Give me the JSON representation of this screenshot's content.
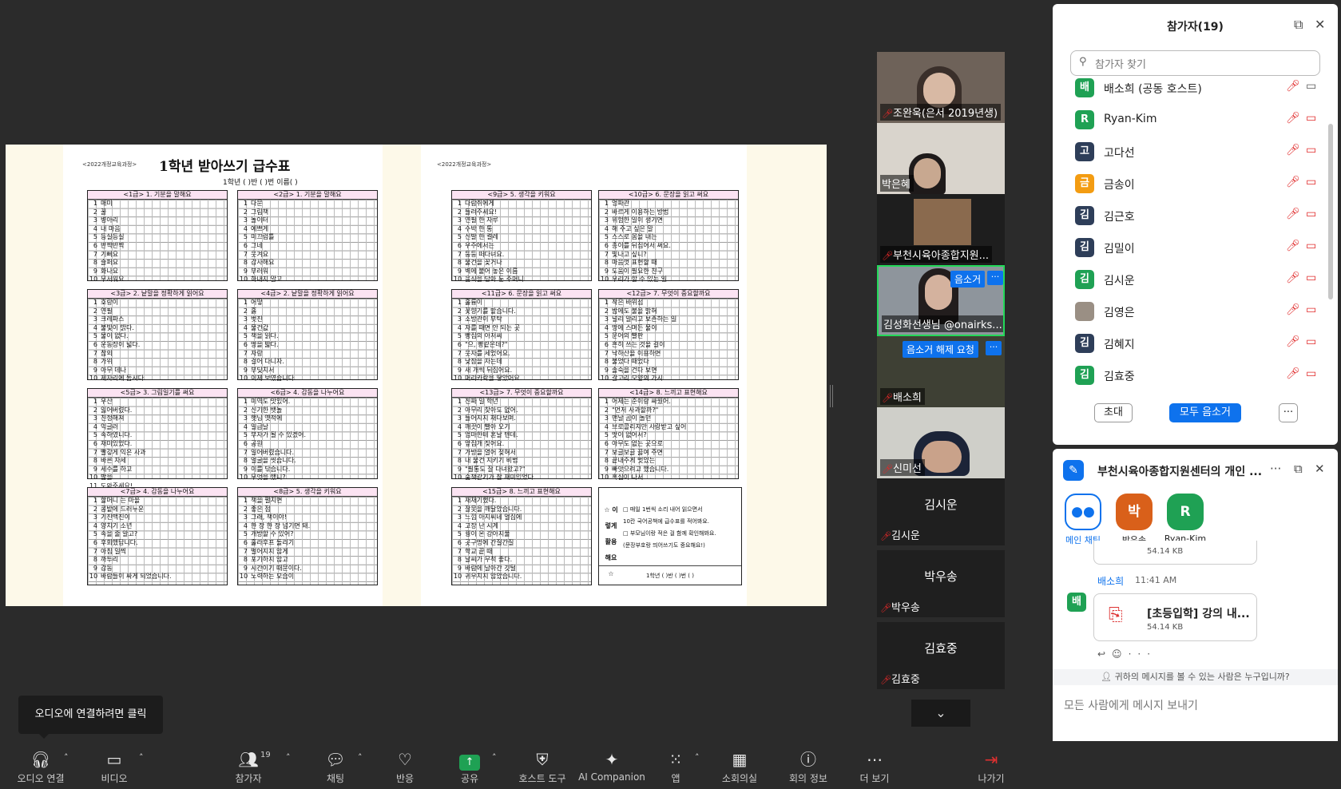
{
  "document": {
    "left_header": "<2022개정교육과정>",
    "right_header": "<2022개정교육과정>",
    "title": "1학년 받아쓰기 급수표",
    "subline": "1학년 (    )반 (    )번 이름(             )",
    "boxes": [
      {
        "title": "<1급> 1. 기분을 말해요",
        "rows": [
          "매미",
          "꿀",
          "병아리",
          "내 마음",
          "등실등실",
          "반짝반짝",
          "기뻐요",
          "슬퍼요",
          "화나요",
          "무서워요"
        ]
      },
      {
        "title": "<2급> 1. 기분을 말해요",
        "rows": [
          "다문",
          "그림책",
          "놀이터",
          "예쁘게",
          "미끄럼틀",
          "그네",
          "웃겨요",
          "감사해요",
          "부러워",
          "하내지 말고"
        ]
      },
      {
        "title": "<3급> 2. 낱말을 정확하게 읽어요",
        "rows": [
          "호랑이",
          "연필",
          "크레파스",
          "불빛이 밝다.",
          "물이 없다.",
          "운동장이 넓다.",
          "참외",
          "가위",
          "아무 데나",
          "제자리에 둡시다."
        ]
      },
      {
        "title": "<4급> 2. 낱말을 정확하게 읽어요",
        "rows": [
          "어떻",
          "흙",
          "벗진",
          "물건값",
          "책을 읽다.",
          "땅을 밟다.",
          "자랑",
          "걸어 다니자.",
          "부딪치서",
          "이제 보였습니다."
        ]
      },
      {
        "title": "<5급> 3. 그림일기를 써요",
        "rows": [
          "우산",
          "잃어버렸다.",
          "친정해져",
          "익글러",
          "속하였니다.",
          "재미있었다.",
          "빨갛게 익은 사과",
          "바른 자세",
          "세수를 하고",
          "밥을",
          "도와주세요!"
        ]
      },
      {
        "title": "<6급> 4. 감동을 나누어요",
        "rows": [
          "미역도 맛있어.",
          "신기한 뱃놀",
          "햇님 옛적에",
          "일급날",
          "부자가 될 수 있겠어.",
          "공원",
          "일어버렸습니다.",
          "얼굴을 씻습니다.",
          "이를 닦습니다.",
          "무엇을 했니?"
        ]
      },
      {
        "title": "<7급> 4. 감동을 나누어요",
        "rows": [
          "할머니 는 마을",
          "콩밭에 드러누운",
          "기진맥진이",
          "양치기 소년",
          "속을 줄 알고?",
          "후회했답니다.",
          "아침 일찍",
          "까투리",
          "감동",
          "바람들이 싸게 되었습니다."
        ]
      },
      {
        "title": "<8급> 5. 생각을 키워요",
        "rows": [
          "책을 펼치면",
          "좋은 점",
          "그래, 책이야!",
          "한 장 한 장 넘기면 돼.",
          "개방할 수 있어?",
          "훌라후프 돌리기",
          "벌어지지 않게",
          "포기하지 않고",
          "시간이기 때문이다.",
          "노력하는 모습이"
        ]
      },
      {
        "title": "<9급> 5. 생각을 키워요",
        "rows": [
          "다람쥐에게",
          "들려주세요!",
          "연필 한 자루",
          "수박 한 통",
          "신발 한 켤레",
          "우주에서는",
          "둥둥 떠다녀요.",
          "물건을 꽂거나",
          "벽에 붙어 놓은 이름",
          "음식을 담아 둔 주머니"
        ]
      },
      {
        "title": "<10급> 6. 문장을 읽고 써요",
        "rows": [
          "엉파관",
          "바르게 이용하는 방법",
          "위험한 일이 생기면",
          "해 주고 싶은 말",
          "스스로 몸을 내는",
          "종이를 뒤집어서 써요.",
          "빛나고 싶니?",
          "마음껏 표현할 때",
          "도움이 필요한 친구",
          "우리가 할 수 있는 일"
        ]
      },
      {
        "title": "<11급> 6. 문장을 읽고 써요",
        "rows": [
          "훌륭이",
          "꽃향기를 맡습니다.",
          "소방관이 부탁",
          "자를 때면 안 되는 곳",
          "빵집의 아저씨",
          "\"으, 빵같은데?\"",
          "웃자를 세었어요.",
          "낮잠을 자는데",
          "새 개씩 뒤집어요.",
          "머리카락을 땋았어요."
        ]
      },
      {
        "title": "<12급> 7. 무엇이 중요할까요",
        "rows": [
          "작은 바위섬",
          "밤에도 불을 밝혀",
          "널리 알리고 보존하는 일",
          "땅에 스며든 물이",
          "문어의 빨판",
          "흔히 쓰는 것을 걸이",
          "낙하산을 이용하면",
          "불었다 때었다",
          "솔숙을 건다 보면",
          "갈고리 모양의 가시"
        ]
      },
      {
        "title": "<13급> 7. 무엇이 중요할까요",
        "rows": [
          "진짜 일 학년",
          "아무리 찾아도 없어.",
          "들어지지 채다보며.",
          "깨끗이 빨아 오기",
          "엄마한테 혼날 텐데.",
          "앞집개 짖어요.",
          "가방을 열어 젖혀서",
          "내 물건 지키기 비법",
          "\"필통도 잘 다녀왔고?\"",
          "숨책같기가 참 재미있었다."
        ]
      },
      {
        "title": "<14급> 8. 느끼고 표현해요",
        "rows": [
          "어제는 준이랑 싸웠어.",
          "\"먼저 사과할까?\"",
          "맨날 곰이 놀던",
          "브로콜리지만 사랑받고 싶어",
          "맛이 없어서?",
          "아무도 없는 곳으로",
          "보글보글 끓여 주면",
          "끝내주게 멋있는",
          "빠앗으려고 했습니다.",
          "혹심이 나서"
        ]
      },
      {
        "title": "<15급> 8. 느끼고 표현해요",
        "rows": [
          "재채기했다.",
          "잘못을 깨달았습니다.",
          "느낌 아지씨네 얼집에",
          "고장 난 시계",
          "꿩이 온 강아지풀",
          "곳구멍에 간질간질",
          "학교 끝 때",
          "날씨가 무척 좋다.",
          "바람에 날아간 깃털",
          "귀우치지 않았습니다."
        ]
      }
    ],
    "note": {
      "side": "☆ 이렇게 활용해요 ☆",
      "lines": [
        "□ 매일 1번씩 소리 내어 읽으면서",
        "10칸 국어공책에 급수표를 적어봐요.",
        "□ 부모님이랑 적은 걸 함께 확인해봐요.",
        "(문장부호랑 띄어쓰기도 중요해요!)"
      ],
      "footer": "1학년 (    )반 (    )번 (          )"
    }
  },
  "videos": {
    "tiles": [
      {
        "name": "조완욱(은서 2019년생)",
        "muted": true
      },
      {
        "name": "박은혜",
        "muted": false
      },
      {
        "name": "부천시육아종합지원...",
        "muted": true
      },
      {
        "name": "김성화선생님 @onairks...",
        "muted": false,
        "tag": "음소거"
      },
      {
        "name": "배소희",
        "muted": true,
        "tag": "음소거 해제 요청"
      },
      {
        "name": "신미선",
        "muted": true
      }
    ],
    "name_tiles": [
      {
        "big": "김시운",
        "small": "김시운"
      },
      {
        "big": "박우송",
        "small": "박우송"
      },
      {
        "big": "김효중",
        "small": "김효중"
      }
    ],
    "more_label": "···"
  },
  "participants": {
    "title": "참가자(19)",
    "search_placeholder": "참가자 찾기",
    "list": [
      {
        "initial": "배",
        "name": "배소희 (공동 호스트)",
        "color": "#1fa154",
        "cam_on": true
      },
      {
        "initial": "R",
        "name": "Ryan-Kim",
        "color": "#1fa154",
        "cam_on": false
      },
      {
        "initial": "고",
        "name": "고다선",
        "color": "#2e3e59",
        "cam_on": false
      },
      {
        "initial": "금",
        "name": "금송이",
        "color": "#f39c12",
        "cam_on": false
      },
      {
        "initial": "김",
        "name": "김근호",
        "color": "#2e3e59",
        "cam_on": false
      },
      {
        "initial": "김",
        "name": "김밀이",
        "color": "#2e3e59",
        "cam_on": false
      },
      {
        "initial": "김",
        "name": "김시운",
        "color": "#1fa154",
        "cam_on": false
      },
      {
        "initial": "",
        "name": "김영은",
        "color": "#9a8f84",
        "cam_on": false
      },
      {
        "initial": "김",
        "name": "김혜지",
        "color": "#2e3e59",
        "cam_on": false
      },
      {
        "initial": "김",
        "name": "김효중",
        "color": "#1fa154",
        "cam_on": false
      }
    ],
    "invite_label": "초대",
    "mute_all_label": "모두 음소거",
    "more_label": "···"
  },
  "chat": {
    "title": "부천시육아종합지원센터의 개인 ...",
    "channels": [
      {
        "initial": "",
        "label": "메인 채팅",
        "color": "#ffffff",
        "selected": true
      },
      {
        "initial": "박",
        "label": "박우송",
        "color": "#d9601a",
        "selected": false
      },
      {
        "initial": "R",
        "label": "Ryan-Kim",
        "color": "#1fa154",
        "selected": false
      }
    ],
    "prev_file_size": "54.14 KB",
    "sender": "배소희",
    "time": "11:41 AM",
    "sender_initial": "배",
    "file_name": "[초등입학] 강의 내...",
    "file_size": "54.14 KB",
    "privacy_note": "귀하의 메시지를 볼 수 있는 사람은 누구입니까?",
    "input_placeholder": "모든 사람에게 메시지 보내기"
  },
  "tooltip": "오디오에 연결하려면 클릭",
  "toolbar": {
    "audio": "오디오 연결",
    "video": "비디오",
    "participants": "참가자",
    "participants_count": "19",
    "chat": "채팅",
    "reactions": "반응",
    "share": "공유",
    "host_tools": "호스트 도구",
    "ai": "AI Companion",
    "apps": "앱",
    "breakout": "소회의실",
    "info": "회의 정보",
    "more": "더 보기",
    "leave": "나가기"
  }
}
